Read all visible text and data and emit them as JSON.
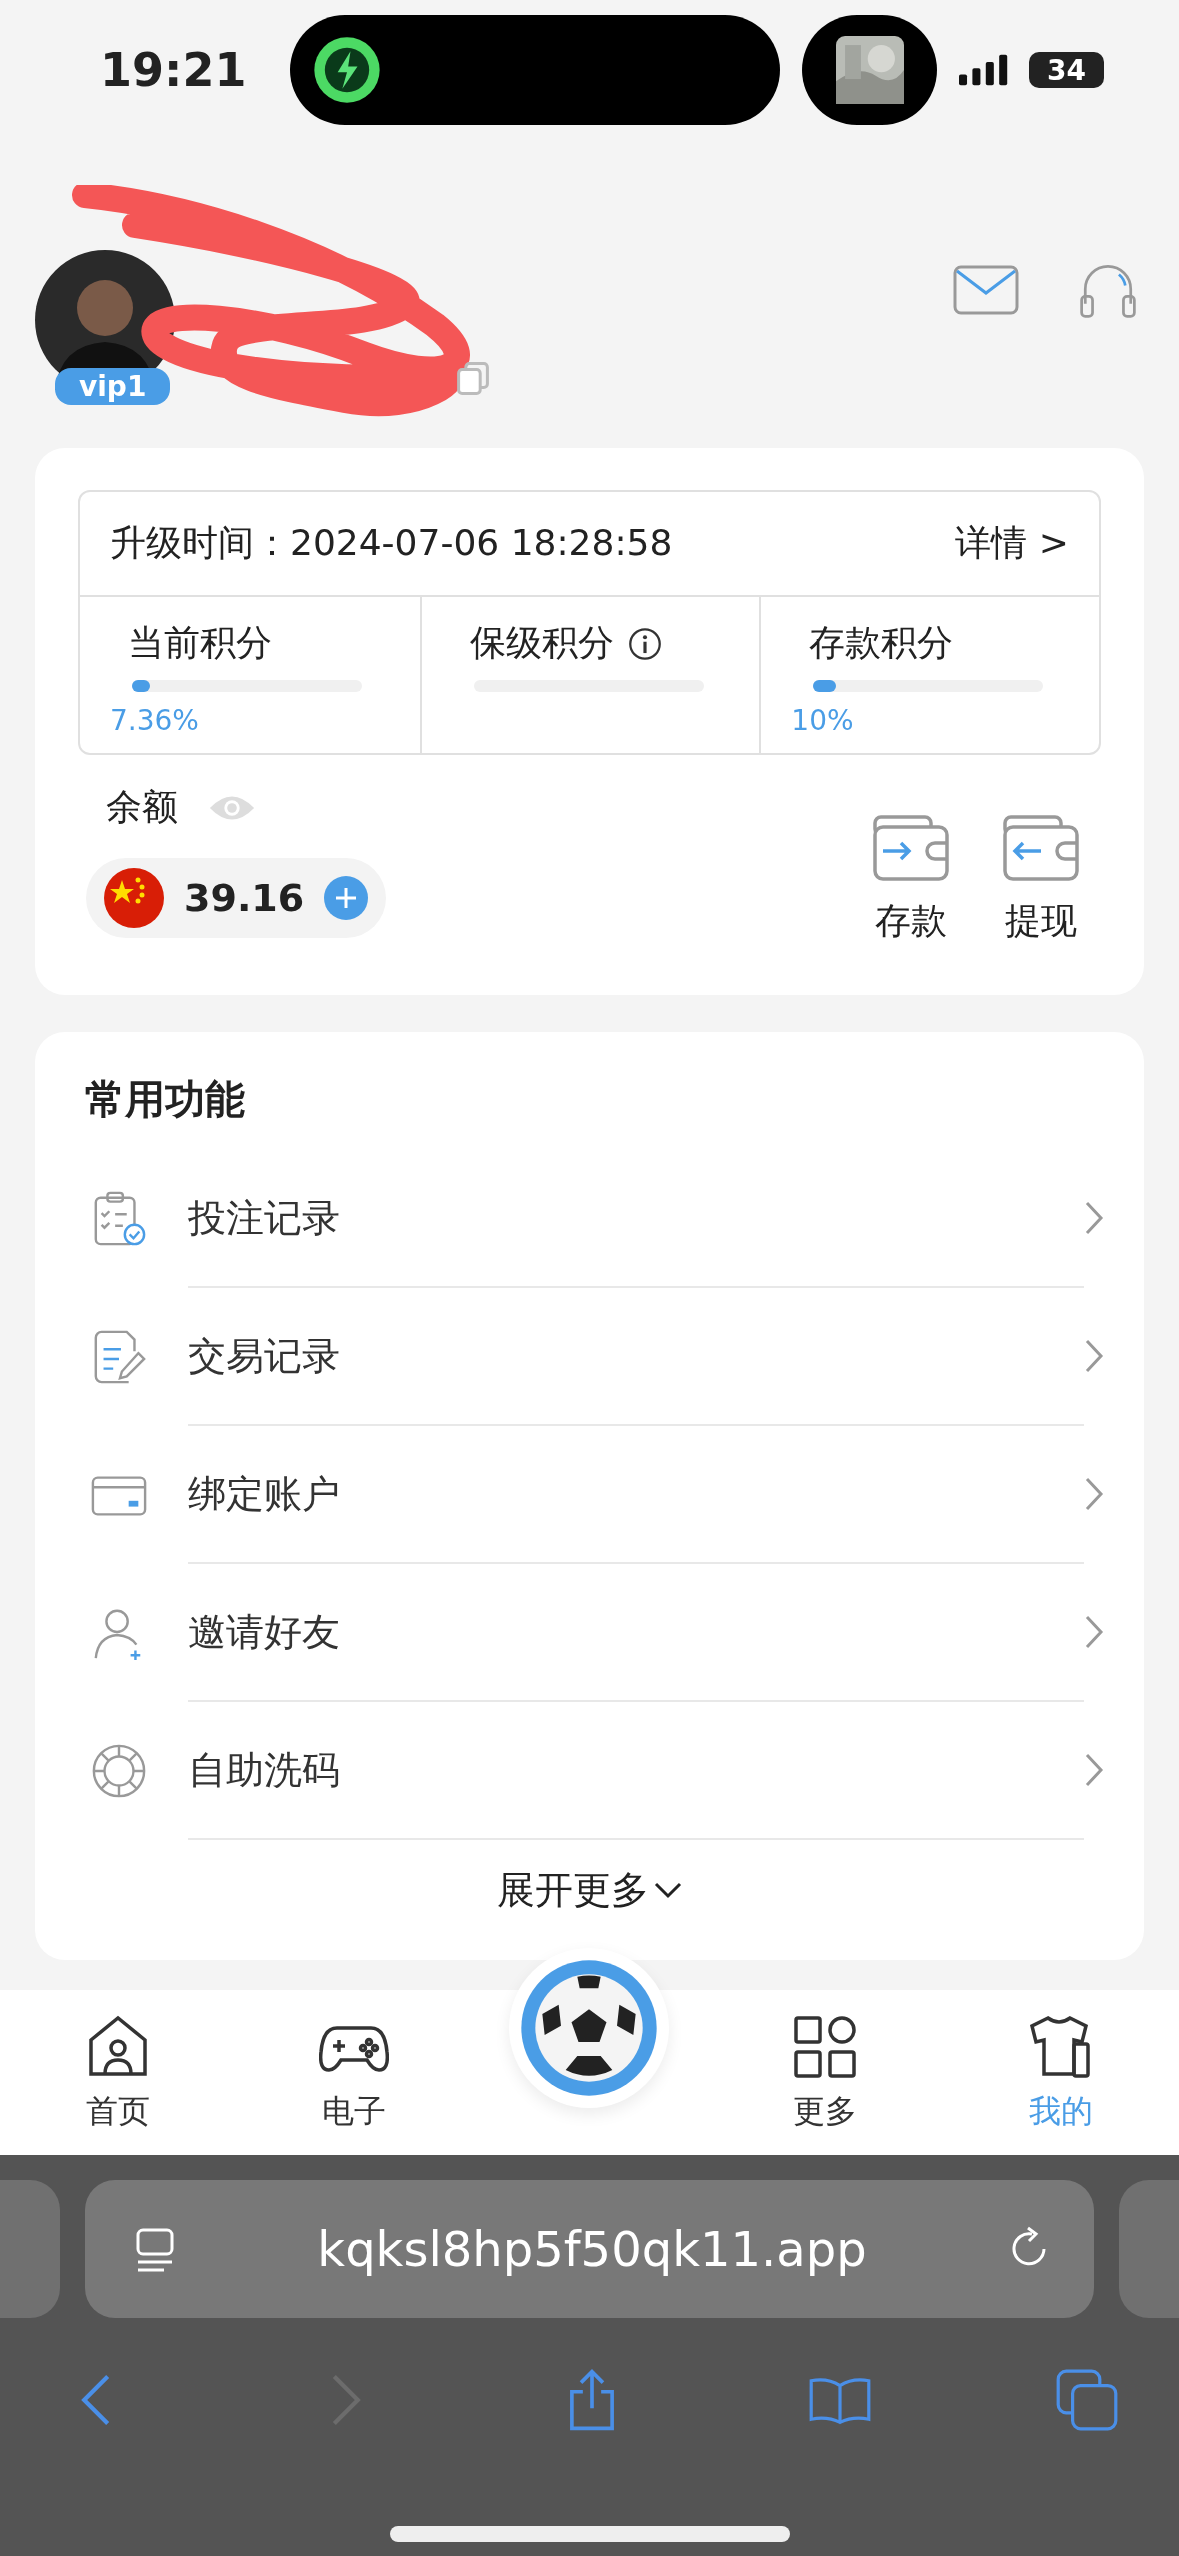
{
  "status_bar": {
    "time": "19:21",
    "battery": "34"
  },
  "profile": {
    "vip": "vip1"
  },
  "level_card": {
    "upgrade_label": "升级时间：",
    "upgrade_time": "2024-07-06 18:28:58",
    "details": "详情 >",
    "stats": [
      {
        "label": "当前积分",
        "info": false,
        "level": 0.0736,
        "reading": "7.36%"
      },
      {
        "label": "保级积分",
        "info": true
      },
      {
        "label": "存款积分",
        "info": false,
        "level": 0.1,
        "reading": "10%"
      }
    ],
    "balance_label": "余额",
    "amount": "39.16",
    "actions": [
      {
        "label": "存款",
        "kind": "deposit"
      },
      {
        "label": "提现",
        "kind": "withdraw"
      }
    ]
  },
  "functions": {
    "title": "常用功能",
    "items": [
      {
        "label": "投注记录",
        "kind": "bets"
      },
      {
        "label": "交易记录",
        "kind": "transactions"
      },
      {
        "label": "绑定账户",
        "kind": "card"
      },
      {
        "label": "邀请好友",
        "kind": "invite"
      },
      {
        "label": "自助洗码",
        "kind": "chip"
      }
    ],
    "more": "展开更多"
  },
  "tab_bar": {
    "tabs": [
      {
        "label": "首页",
        "kind": "home",
        "selected": false
      },
      {
        "label": "电子",
        "kind": "games",
        "selected": false
      },
      {
        "kind": "ball",
        "selected": false
      },
      {
        "label": "更多",
        "kind": "more",
        "selected": false
      },
      {
        "label": "我的",
        "kind": "mine",
        "selected": true
      }
    ]
  },
  "browser": {
    "url": "kqksl8hp5f50qk11.app",
    "back_disabled": false,
    "forward_disabled": true
  }
}
